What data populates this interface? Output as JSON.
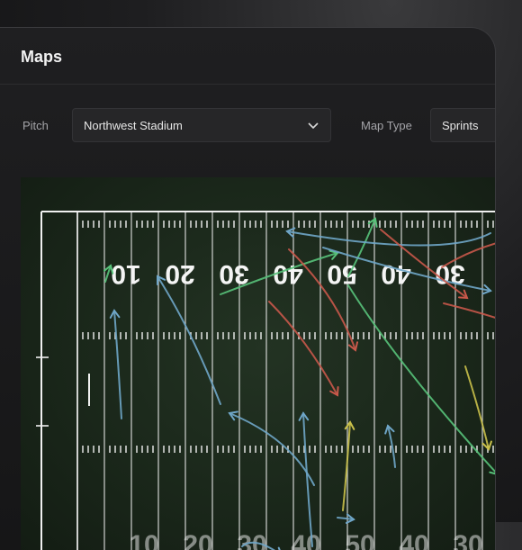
{
  "page": {
    "title": "Maps"
  },
  "filters": {
    "pitch": {
      "label": "Pitch",
      "value": "Northwest Stadium"
    },
    "map_type": {
      "label": "Map Type",
      "value": "Sprints"
    }
  },
  "field": {
    "top_numbers": [
      "10",
      "20",
      "30",
      "40",
      "50",
      "40",
      "30"
    ],
    "bottom_numbers": [
      "10",
      "20",
      "30",
      "40",
      "50",
      "40",
      "30"
    ],
    "colors": {
      "turf": "#1e2c1e",
      "lines": "#f0f0f0",
      "sprint_blue": "#6fa6c8",
      "sprint_red": "#c8584a",
      "sprint_green": "#58c27a",
      "sprint_yellow": "#c9c04a"
    }
  }
}
